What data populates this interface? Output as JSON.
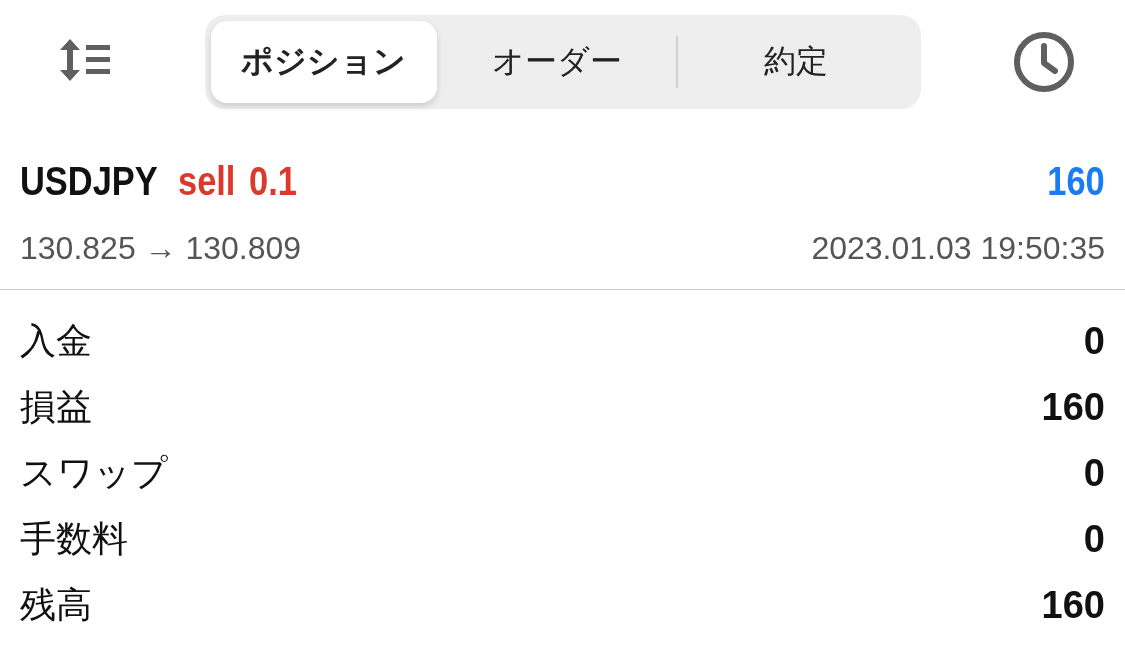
{
  "tabs": [
    {
      "label": "ポジション",
      "selected": true
    },
    {
      "label": "オーダー",
      "selected": false
    },
    {
      "label": "約定",
      "selected": false
    }
  ],
  "position": {
    "symbol": "USDJPY",
    "side": "sell",
    "volume": "0.1",
    "profit": "160",
    "prices": "130.825 → 130.809",
    "time": "2023.01.03 19:50:35"
  },
  "summary": [
    {
      "label": "入金",
      "value": "0"
    },
    {
      "label": "損益",
      "value": "160"
    },
    {
      "label": "スワップ",
      "value": "0"
    },
    {
      "label": "手数料",
      "value": "0"
    },
    {
      "label": "残高",
      "value": "160"
    }
  ]
}
